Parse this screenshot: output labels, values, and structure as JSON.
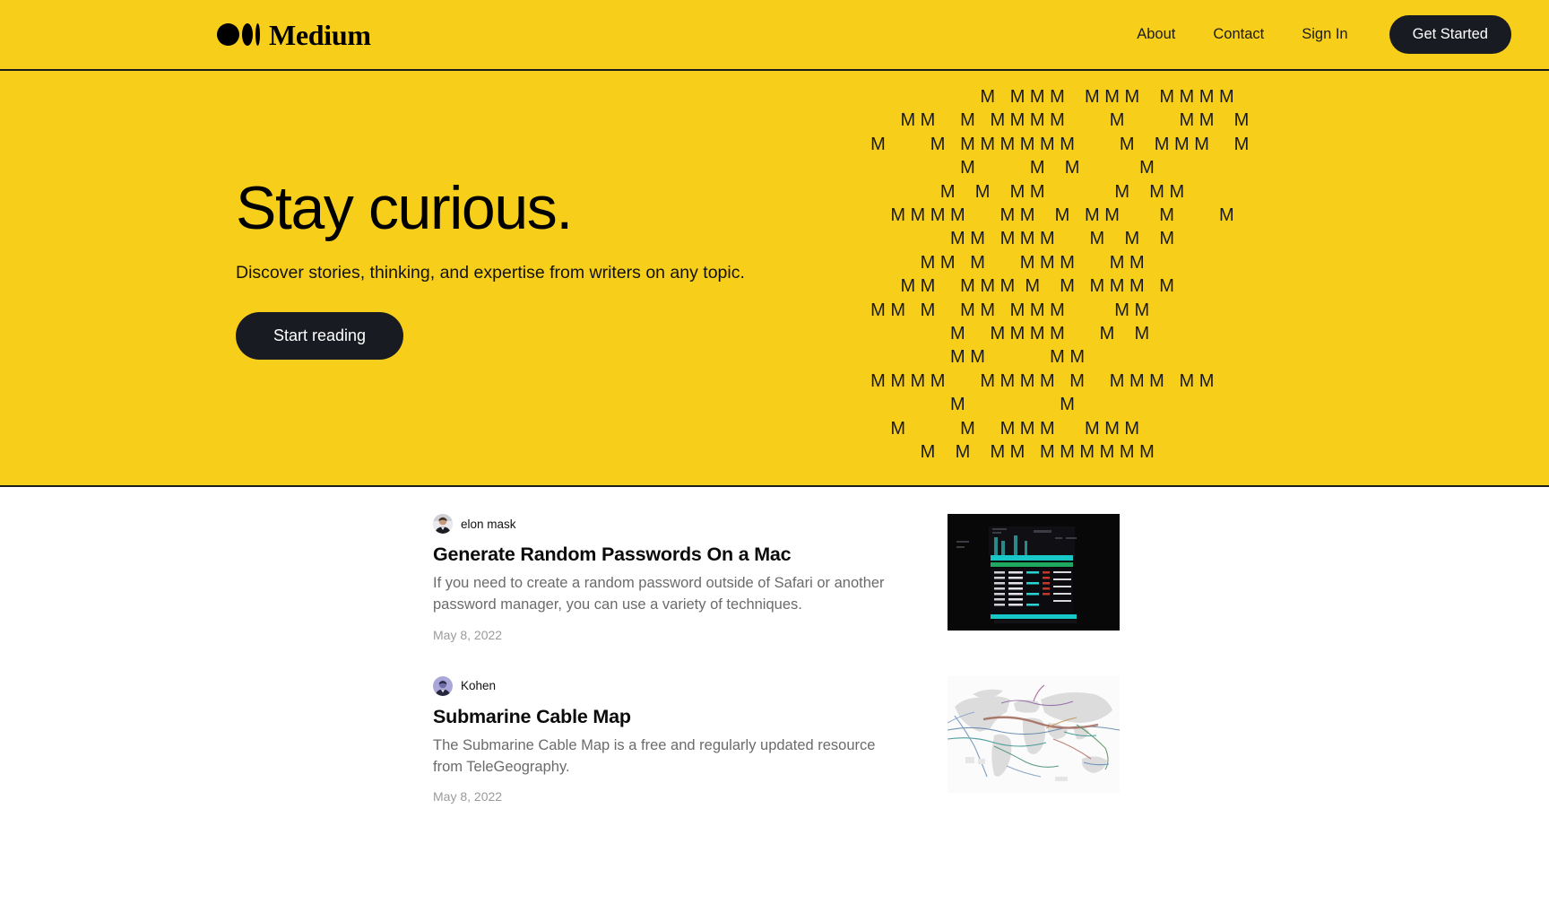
{
  "brand": {
    "name": "Medium",
    "logo_icon": "medium-logo-icon"
  },
  "nav": {
    "links": [
      {
        "label": "About",
        "name": "nav-link-about"
      },
      {
        "label": "Contact",
        "name": "nav-link-contact"
      },
      {
        "label": "Sign In",
        "name": "nav-link-signin"
      }
    ],
    "cta_label": "Get Started"
  },
  "hero": {
    "title": "Stay curious.",
    "subtitle": "Discover stories, thinking, and expertise from writers on any topic.",
    "cta_label": "Start reading",
    "background_color": "#F7CF1A",
    "letter": "M",
    "pattern_rows": [
      "                        M   M M M    M M M    M M M M",
      "        M M     M   M M M M         M           M M    M",
      "  M         M   M M M M M M         M    M M M     M",
      "                    M           M    M            M",
      "                M    M    M M              M    M M",
      "      M M M M       M M    M   M M        M         M",
      "                  M M   M M M       M    M    M",
      "            M M   M       M M M       M M",
      "        M M     M M M  M    M   M M M   M",
      "  M M   M     M M   M M M          M M",
      "                  M     M M M M       M    M",
      "                  M M             M M",
      "  M M M M       M M M M   M     M M M   M M",
      "                  M                   M",
      "      M           M     M M M      M M M",
      "            M    M    M M   M M M M M M"
    ]
  },
  "feed": {
    "articles": [
      {
        "author": "elon mask",
        "avatar_icon": "user-avatar-photo",
        "title": "Generate Random Passwords On a Mac",
        "description": "If you need to create a random password outside of Safari or another password manager, you can use a variety of techniques.",
        "date": "May 8, 2022",
        "thumbnail_icon": "terminal-screenshot-thumbnail"
      },
      {
        "author": "Kohen",
        "avatar_icon": "user-avatar-photo",
        "title": "Submarine Cable Map",
        "description": "The Submarine Cable Map is a free and regularly updated resource from TeleGeography.",
        "date": "May 8, 2022",
        "thumbnail_icon": "world-map-thumbnail"
      }
    ]
  }
}
